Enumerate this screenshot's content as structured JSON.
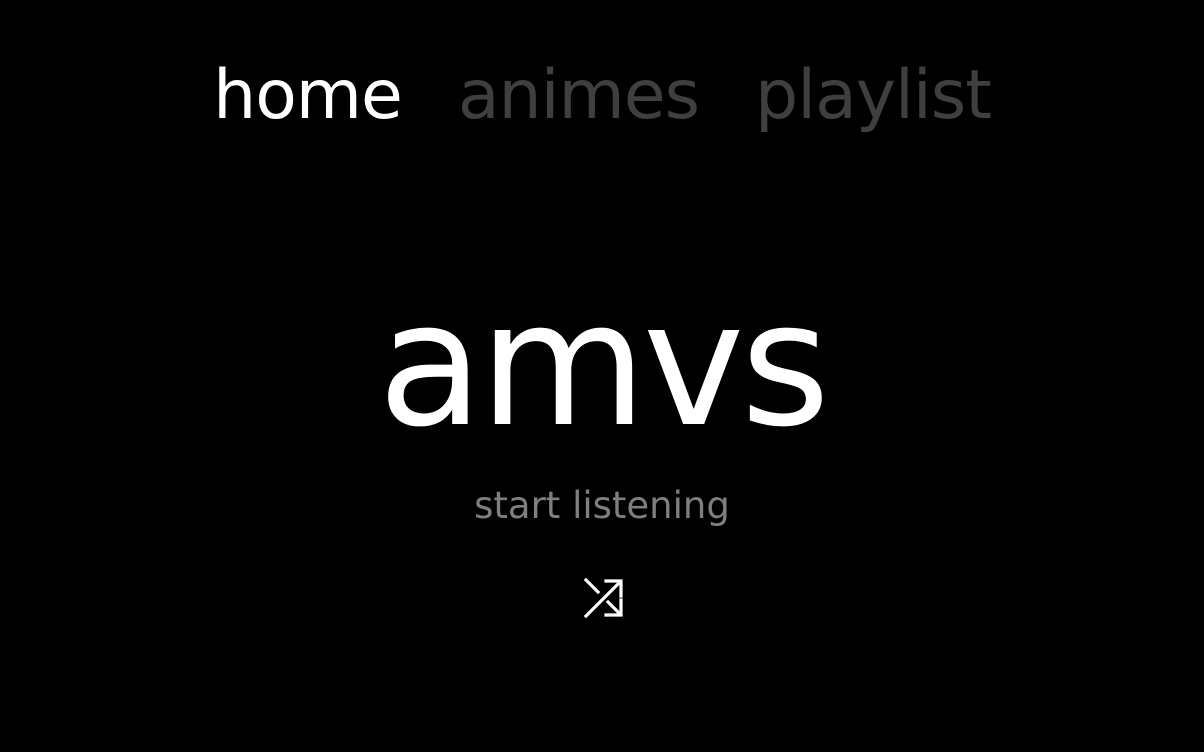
{
  "nav": {
    "items": [
      {
        "label": "home",
        "active": true
      },
      {
        "label": "animes",
        "active": false
      },
      {
        "label": "playlist",
        "active": false
      }
    ]
  },
  "hero": {
    "title": "amvs",
    "subtitle": "start listening"
  },
  "controls": {
    "shuffle_icon": "shuffle-icon"
  },
  "colors": {
    "background": "#000000",
    "active_nav": "#ffffff",
    "inactive_nav": "#3f3f3f",
    "subtitle": "#7f7f7f"
  }
}
